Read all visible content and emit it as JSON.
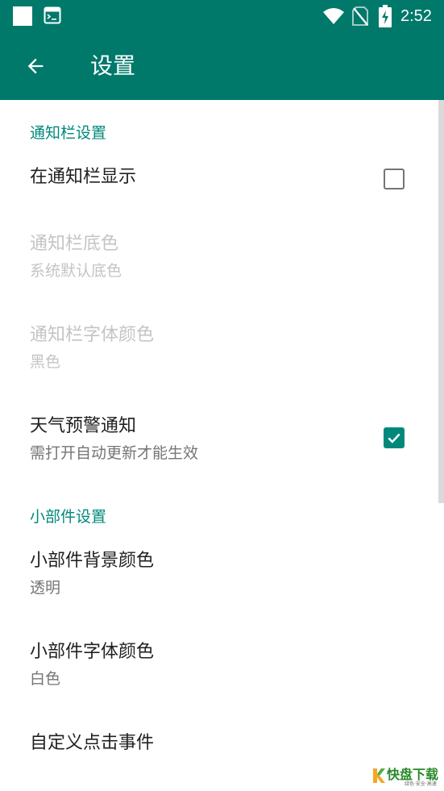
{
  "status_bar": {
    "time": "2:52",
    "icons": [
      "notification-square-icon",
      "terminal-icon",
      "wifi-icon",
      "no-sim-icon",
      "battery-charging-icon"
    ]
  },
  "app_bar": {
    "title": "设置",
    "back_icon": "arrow-back-icon"
  },
  "sections": {
    "notification": {
      "header": "通知栏设置",
      "items": [
        {
          "title": "在通知栏显示",
          "checked": false
        },
        {
          "title": "通知栏底色",
          "summary": "系统默认底色",
          "enabled": false
        },
        {
          "title": "通知栏字体颜色",
          "summary": "黑色",
          "enabled": false
        },
        {
          "title": "天气预警通知",
          "summary": "需打开自动更新才能生效",
          "checked": true
        }
      ]
    },
    "widget": {
      "header": "小部件设置",
      "items": [
        {
          "title": "小部件背景颜色",
          "summary": "透明"
        },
        {
          "title": "小部件字体颜色",
          "summary": "白色"
        },
        {
          "title": "自定义点击事件"
        }
      ]
    }
  },
  "watermark": {
    "text": "快盘下载",
    "subtext": "绿色·安全·高速"
  },
  "colors": {
    "primary": "#00796b",
    "accent": "#00897b",
    "text_primary": "#212121",
    "text_secondary": "#757575",
    "text_disabled": "#c4c4c4"
  }
}
